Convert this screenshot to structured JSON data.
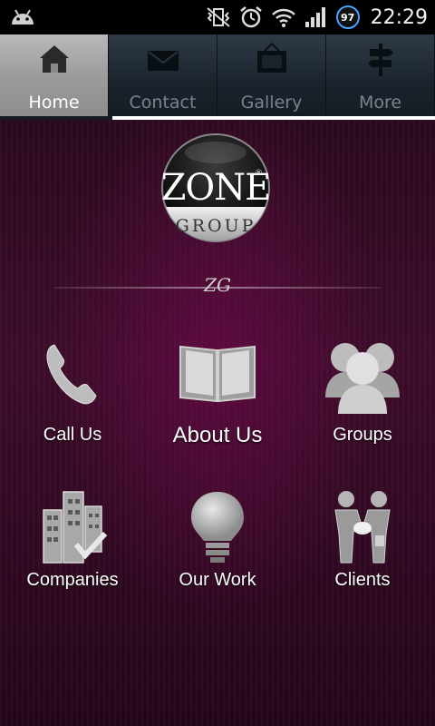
{
  "status_bar": {
    "battery_level": "97",
    "time": "22:29",
    "icons": [
      "android-icon",
      "vibrate-mute-icon",
      "alarm-icon",
      "wifi-icon",
      "signal-icon"
    ]
  },
  "tabs": [
    {
      "label": "Home",
      "icon": "home-icon",
      "active": true
    },
    {
      "label": "Contact",
      "icon": "envelope-icon",
      "active": false
    },
    {
      "label": "Gallery",
      "icon": "picture-frame-icon",
      "active": false
    },
    {
      "label": "More",
      "icon": "signpost-icon",
      "active": false
    }
  ],
  "logo": {
    "top_text": "ZONE",
    "bottom_text": "GROUP",
    "reg_mark": "®"
  },
  "monogram": "ZG",
  "grid": [
    {
      "label": "Call Us",
      "icon": "phone-icon"
    },
    {
      "label": "About Us",
      "icon": "book-icon"
    },
    {
      "label": "Groups",
      "icon": "people-group-icon"
    },
    {
      "label": "Companies",
      "icon": "buildings-check-icon"
    },
    {
      "label": "Our Work",
      "icon": "lightbulb-icon"
    },
    {
      "label": "Clients",
      "icon": "handshake-icon"
    }
  ],
  "colors": {
    "status_bg": "#000000",
    "tab_active_bg": "#a5a5a5",
    "tab_inactive_bg": "#1a232c",
    "main_bg": "#3c0c2a",
    "battery_ring": "#4aa3ff"
  }
}
